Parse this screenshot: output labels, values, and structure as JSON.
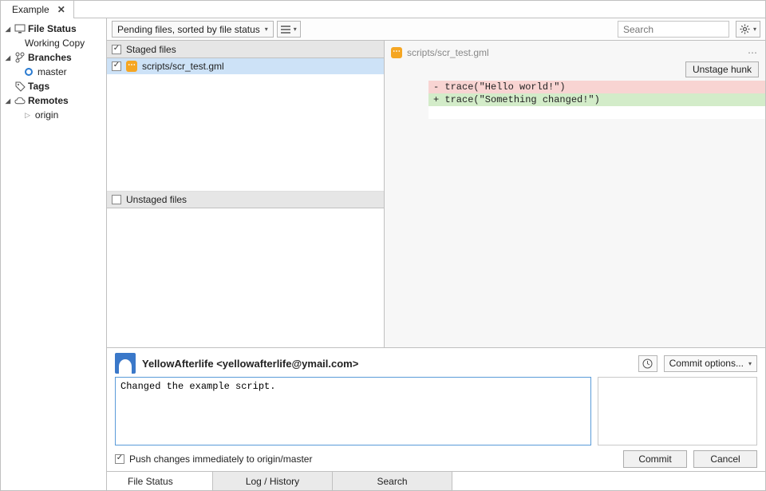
{
  "tabs": {
    "items": [
      {
        "label": "Example"
      }
    ]
  },
  "sidebar": {
    "fileStatus": {
      "label": "File Status",
      "sub": "Working Copy"
    },
    "branches": {
      "label": "Branches",
      "items": [
        {
          "label": "master"
        }
      ]
    },
    "tags": {
      "label": "Tags"
    },
    "remotes": {
      "label": "Remotes",
      "items": [
        {
          "label": "origin"
        }
      ]
    }
  },
  "toolbar": {
    "filter_label": "Pending files, sorted by file status",
    "search_placeholder": "Search"
  },
  "staged": {
    "header": "Staged files",
    "files": [
      {
        "path": "scripts/scr_test.gml"
      }
    ]
  },
  "unstaged": {
    "header": "Unstaged files"
  },
  "diff": {
    "file": "scripts/scr_test.gml",
    "unstage_label": "Unstage hunk",
    "removed": "- trace(\"Hello world!\")",
    "added": "+ trace(\"Something changed!\")"
  },
  "commit": {
    "author": "YellowAfterlife <yellowafterlife@ymail.com>",
    "options_label": "Commit options...",
    "message": "Changed the example script.",
    "push_label": "Push changes immediately to origin/master",
    "commit_btn": "Commit",
    "cancel_btn": "Cancel"
  },
  "bottom_tabs": {
    "file_status": "File Status",
    "log": "Log / History",
    "search": "Search"
  }
}
